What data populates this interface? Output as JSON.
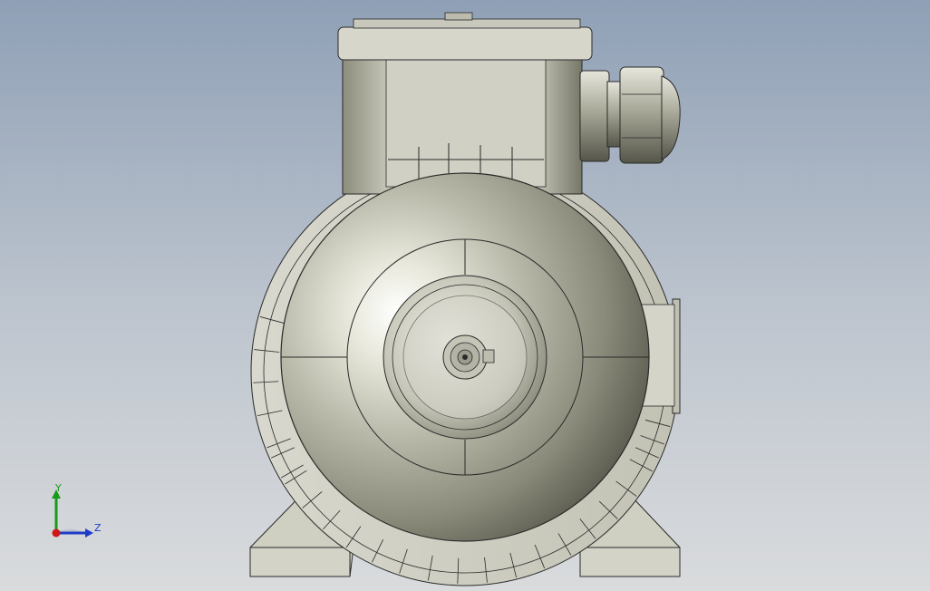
{
  "viewport": {
    "background_top": "#8fa0b6",
    "background_bottom": "#d9dbdd"
  },
  "model": {
    "parts": [
      "terminal-box",
      "cable-gland",
      "fan-cowl",
      "motor-frame",
      "mounting-feet",
      "shaft-end"
    ],
    "metal_color": "#c9c9bd",
    "edge_color": "#2a2a2a"
  },
  "triad": {
    "y_label": "Y",
    "z_label": "Z",
    "y_color": "#1a9a1a",
    "z_color": "#1e3cc8",
    "x_color": "#d01818"
  }
}
